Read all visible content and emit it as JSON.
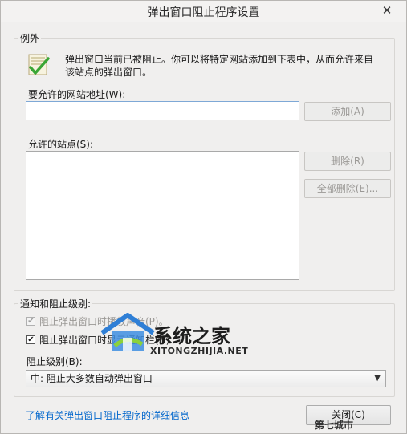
{
  "window": {
    "title": "弹出窗口阻止程序设置",
    "close_glyph": "✕"
  },
  "exceptions": {
    "group_label": "例外",
    "info_line1": "弹出窗口当前已被阻止。你可以将特定网站添加到下表中，从而允许来自",
    "info_line2": "该站点的弹出窗口。",
    "address_label": "要允许的网站地址(W):",
    "address_value": "",
    "add_button": "添加(A)",
    "sites_label": "允许的站点(S):",
    "sites": [],
    "remove_button": "删除(R)",
    "remove_all_button": "全部删除(E)..."
  },
  "notify": {
    "group_label": "通知和阻止级别:",
    "sound_label": "阻止弹出窗口时播放声音(P)。",
    "sound_checked": true,
    "bar_label": "阻止弹出窗口时显示通知栏(N)",
    "bar_checked": true,
    "level_label": "阻止级别(B):",
    "level_value": "中: 阻止大多数自动弹出窗口"
  },
  "footer": {
    "learn_more": "了解有关弹出窗口阻止程序的详细信息",
    "close_button": "关闭(C)"
  },
  "watermark": {
    "brand": "系统之家",
    "brand_url": "XITONGZHIJIA.NET",
    "corner": "第七城市"
  },
  "icons": {
    "info": "shield-check-icon",
    "close": "close-icon",
    "dropdown": "chevron-down-icon"
  }
}
